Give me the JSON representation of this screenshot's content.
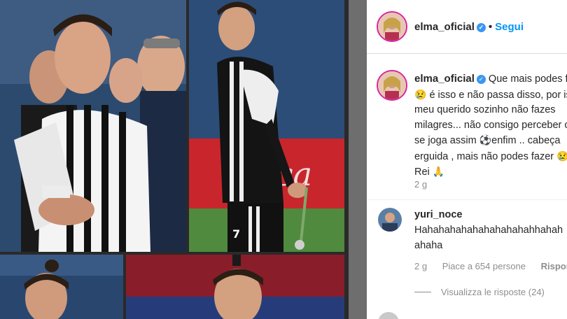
{
  "header": {
    "username": "elma_oficial",
    "dot": "•",
    "follow_label": "Segui"
  },
  "caption": {
    "username": "elma_oficial",
    "text_line1": "Que mais podes faz",
    "text_line2": "é isso e não passa disso, por isso",
    "text_line3": "meu querido sozinho não fazes",
    "text_line4": "milagres... não consigo perceber co",
    "text_line5": "se joga assim",
    "text_line5b": "enfim .. cabeça",
    "text_line6": "erguida , mais não podes fazer",
    "text_line7": "Rei",
    "time": "2 g"
  },
  "comment": {
    "username": "yuri_noce",
    "text_line1": "Hahahahahahahahahahahhahah",
    "text_line2": "ahaha",
    "time": "2 g",
    "likes": "Piace a 654 persone",
    "reply_label": "Rispondi"
  },
  "view_replies": "Visualizza le risposte (24)",
  "icons": [
    "verified-badge-icon",
    "soccer-ball-icon",
    "praying-hands-icon",
    "crying-face-icon"
  ],
  "colors": {
    "accent": "#0095f6",
    "ring": "#d6249f",
    "muted": "#8e8e8e",
    "jersey_black": "#111111"
  }
}
